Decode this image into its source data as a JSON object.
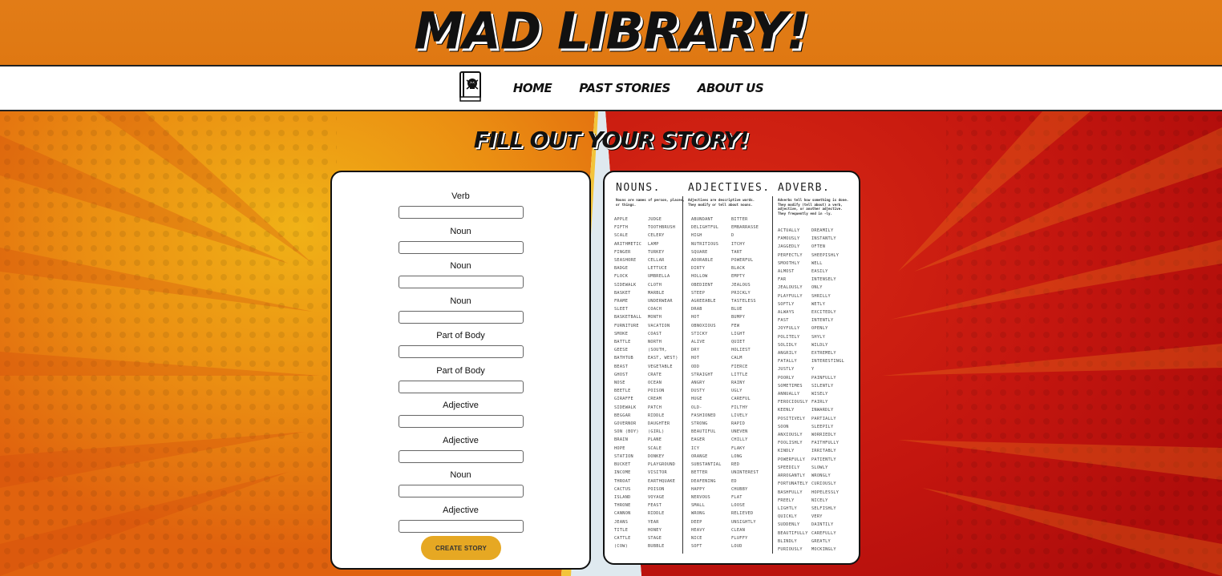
{
  "header": {
    "title": "MAD LIBRARY!"
  },
  "nav": {
    "logo_icon": "skull-book-icon",
    "links": [
      "HOME",
      "PAST STORIES",
      "ABOUT US"
    ]
  },
  "page_title": "FILL OUT YOUR STORY!",
  "form": {
    "fields": [
      {
        "label": "Verb",
        "value": ""
      },
      {
        "label": "Noun",
        "value": ""
      },
      {
        "label": "Noun",
        "value": ""
      },
      {
        "label": "Noun",
        "value": ""
      },
      {
        "label": "Part of Body",
        "value": ""
      },
      {
        "label": "Part of Body",
        "value": ""
      },
      {
        "label": "Adjective",
        "value": ""
      },
      {
        "label": "Adjective",
        "value": ""
      },
      {
        "label": "Noun",
        "value": ""
      },
      {
        "label": "Adjective",
        "value": ""
      }
    ],
    "submit_label": "CREATE STORY"
  },
  "wordbank": {
    "nouns": {
      "title": "NOUNS.",
      "desc": "Nouns are names of person, places, or things.",
      "col1": [
        "APPLE",
        "FIFTH",
        "SCALE",
        "ARITHMETIC",
        "FINGER",
        "SEASHORE",
        "BADGE",
        "FLOCK",
        "SIDEWALK",
        "BASKET",
        "FRAME",
        "SLEET",
        "BASKETBALL",
        "FURNITURE",
        "SMOKE",
        "BATTLE",
        "GEESE",
        "BATHTUB",
        "BEAST",
        "GHOST",
        "NOSE",
        "BEETLE",
        "GIRAFFE",
        "SIDEWALK",
        "BEGGAR",
        "GOVERNOR",
        "SON (BOY)",
        "BRAIN",
        "HOPE",
        "STATION",
        "BUCKET",
        "INCOME",
        "THROAT",
        "CACTUS",
        "ISLAND",
        "THRONE",
        "CANNON",
        "JEANS",
        "TITLE",
        "CATTLE",
        "(COW)"
      ],
      "col2": [
        "JUDGE",
        "TOOTHBRUSH",
        "CELERY",
        "LAMP",
        "TURKEY",
        "CELLAR",
        "LETTUCE",
        "UMBRELLA",
        "CLOTH",
        "MARBLE",
        "UNDERWEAR",
        "COACH",
        "MONTH",
        "VACATION",
        "COAST",
        "NORTH",
        "(SOUTH,",
        "EAST, WEST)",
        "VEGETABLE",
        "CRATE",
        "OCEAN",
        "POISON",
        "CREAM",
        "PATCH",
        "RIDDLE",
        "DAUGHTER",
        "(GIRL)",
        "PLANE",
        "SCALE",
        "DONKEY",
        "PLAYGROUND",
        "VISITOR",
        "EARTHQUAKE",
        "POISON",
        "VOYAGE",
        "FEAST",
        "RIDDLE",
        "YEAR",
        "HONEY",
        "STAGE",
        "BUBBLE"
      ]
    },
    "adjectives": {
      "title": "ADJECTIVES.",
      "desc": "Adjectives are descriptive words. They modify or tell about nouns.",
      "col1": [
        "ABUNDANT",
        "DELIGHTFUL",
        "HIGH",
        "NUTRITIOUS",
        "SQUARE",
        "ADORABLE",
        "DIRTY",
        "HOLLOW",
        "OBEDIENT",
        "STEEP",
        "AGREEABLE",
        "DRAB",
        "HOT",
        "OBNOXIOUS",
        "STICKY",
        "ALIVE",
        "DRY",
        "HOT",
        "ODD",
        "STRAIGHT",
        "ANGRY",
        "DUSTY",
        "HUGE",
        "OLD-",
        "FASHIONED",
        "STRONG",
        "BEAUTIFUL",
        "EAGER",
        "ICY",
        "ORANGE",
        "SUBSTANTIAL",
        "BETTER",
        "DEAFENING",
        "HAPPY",
        "NERVOUS",
        "SMALL",
        "WRONG",
        "DEEP",
        "HEAVY",
        "NICE",
        "SOFT"
      ],
      "col2": [
        "BITTER",
        "EMBARRASSE",
        "D",
        "ITCHY",
        "TART",
        "POWERFUL",
        "BLACK",
        "EMPTY",
        "JEALOUS",
        "PRICKLY",
        "TASTELESS",
        "BLUE",
        "BUMPY",
        "FEW",
        "LIGHT",
        "QUIET",
        "HOLIEST",
        "CALM",
        "FIERCE",
        "LITTLE",
        "RAINY",
        "UGLY",
        "CAREFUL",
        "FILTHY",
        "LIVELY",
        "RAPID",
        "UNEVEN",
        "CHILLY",
        "FLAKY",
        "LONG",
        "RED",
        "UNINTEREST",
        "ED",
        "CHUBBY",
        "FLAT",
        "LOOSE",
        "RELIEVED",
        "UNSIGHTLY",
        "CLEAN",
        "FLUFFY",
        "LOUD"
      ]
    },
    "adverbs": {
      "title": "ADVERB.",
      "desc": "Adverbs tell how something is done. They modify (tell about) a verb, adjective, or another adjective. They frequently end in -ly.",
      "col1": [
        "ACTUALLY",
        "FAMOUSLY",
        "JAGGEDLY",
        "PERFECTLY",
        "SMOOTHLY",
        "ALMOST",
        "FAR",
        "JEALOUSLY",
        "PLAYFULLY",
        "SOFTLY",
        "ALWAYS",
        "FAST",
        "JOYFULLY",
        "POLITELY",
        "SOLIDLY",
        "ANGRILY",
        "FATALLY",
        "JUSTLY",
        "POORLY",
        "SOMETIMES",
        "ANNUALLY",
        "FEROCIOUSLY",
        "KEENLY",
        "POSITIVELY",
        "SOON",
        "ANXIOUSLY",
        "FOOLISHLY",
        "KINDLY",
        "POWERFULLY",
        "SPEEDILY",
        "ARROGANTLY",
        "FORTUNATELY",
        "BASHFULLY",
        "FREELY",
        "LIGHTLY",
        "QUICKLY",
        "SUDDENLY",
        "BEAUTIFULLY",
        "BLINDLY",
        "FURIOUSLY"
      ],
      "col2": [
        "DREAMILY",
        "INSTANTLY",
        "OFTEN",
        "SHEEPISHLY",
        "WELL",
        "EASILY",
        "INTENSELY",
        "ONLY",
        "SHRILLY",
        "WETLY",
        "EXCITEDLY",
        "INTENTLY",
        "OPENLY",
        "SHYLY",
        "WILDLY",
        "EXTREMELY",
        "INTERESTINGL",
        "Y",
        "PAINFULLY",
        "SILENTLY",
        "WISELY",
        "FAIRLY",
        "INWARDLY",
        "PARTIALLY",
        "SLEEPILY",
        "WORRIEDLY",
        "FAITHFULLY",
        "IRRITABLY",
        "PATIENTLY",
        "SLOWLY",
        "WRONGLY",
        "CURIOUSLY",
        "HOPELESSLY",
        "NICELY",
        "SELFISHLY",
        "VERY",
        "DAINTILY",
        "CAREFULLY",
        "GREATLY",
        "MOCKINGLY"
      ]
    }
  }
}
